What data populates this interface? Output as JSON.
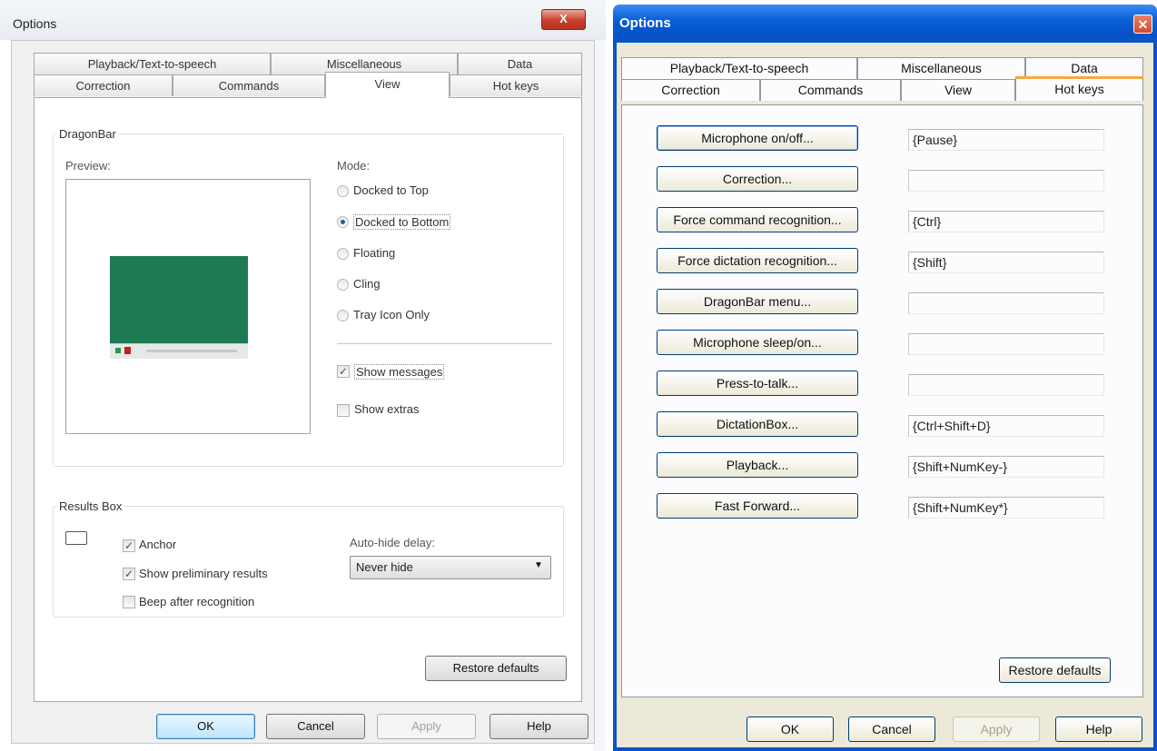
{
  "left_dialog": {
    "title": "Options",
    "close_glyph": "X",
    "tabs_top": [
      "Playback/Text-to-speech",
      "Miscellaneous",
      "Data"
    ],
    "tabs_bottom": [
      "Correction",
      "Commands",
      "View",
      "Hot keys"
    ],
    "selected_tab": "View",
    "dragonbar": {
      "group_title": "DragonBar",
      "preview_label": "Preview:",
      "mode_label": "Mode:",
      "modes": [
        {
          "label": "Docked to Top",
          "selected": false
        },
        {
          "label": "Docked to Bottom",
          "selected": true
        },
        {
          "label": "Floating",
          "selected": false
        },
        {
          "label": "Cling",
          "selected": false
        },
        {
          "label": "Tray Icon Only",
          "selected": false
        }
      ],
      "show_messages": {
        "label": "Show messages",
        "checked": true
      },
      "show_extras": {
        "label": "Show extras",
        "checked": false
      },
      "preview_color": "#1d7a52"
    },
    "results_box": {
      "group_title": "Results Box",
      "anchor": {
        "label": "Anchor",
        "checked": true
      },
      "show_preliminary": {
        "label": "Show preliminary results",
        "checked": true
      },
      "beep": {
        "label": "Beep after recognition",
        "checked": false
      },
      "autohide_label": "Auto-hide delay:",
      "autohide_value": "Never hide"
    },
    "restore_defaults": "Restore defaults",
    "buttons": {
      "ok": "OK",
      "cancel": "Cancel",
      "apply": "Apply",
      "help": "Help"
    }
  },
  "right_dialog": {
    "title": "Options",
    "close_glyph": "✕",
    "tabs_top": [
      "Playback/Text-to-speech",
      "Miscellaneous",
      "Data"
    ],
    "tabs_bottom": [
      "Correction",
      "Commands",
      "View",
      "Hot keys"
    ],
    "selected_tab": "Hot keys",
    "hotkeys": [
      {
        "button": "Microphone on/off...",
        "value": "{Pause}"
      },
      {
        "button": "Correction...",
        "value": ""
      },
      {
        "button": "Force command recognition...",
        "value": "{Ctrl}"
      },
      {
        "button": "Force dictation recognition...",
        "value": "{Shift}"
      },
      {
        "button": "DragonBar menu...",
        "value": ""
      },
      {
        "button": "Microphone sleep/on...",
        "value": ""
      },
      {
        "button": "Press-to-talk...",
        "value": ""
      },
      {
        "button": "DictationBox...",
        "value": "{Ctrl+Shift+D}"
      },
      {
        "button": "Playback...",
        "value": "{Shift+NumKey-}"
      },
      {
        "button": "Fast Forward...",
        "value": "{Shift+NumKey*}"
      }
    ],
    "restore_defaults": "Restore defaults",
    "buttons": {
      "ok": "OK",
      "cancel": "Cancel",
      "apply": "Apply",
      "help": "Help"
    }
  }
}
